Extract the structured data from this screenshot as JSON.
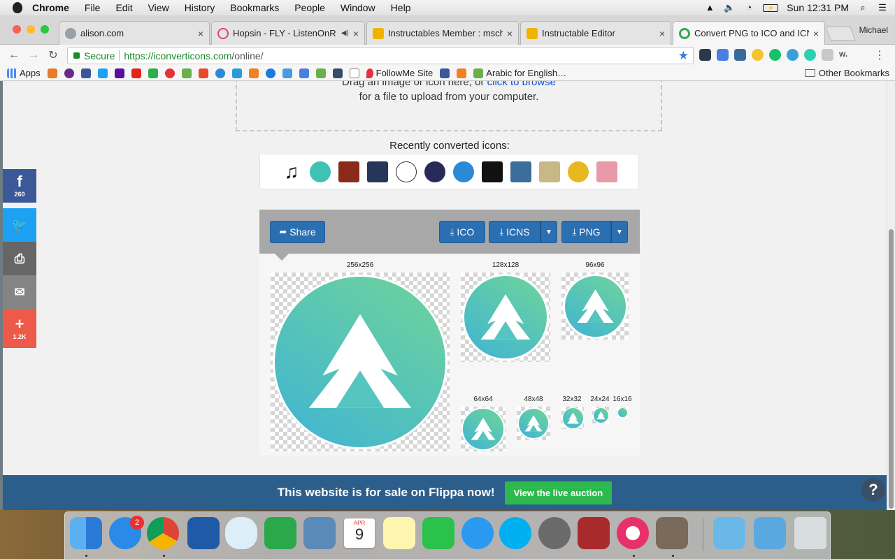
{
  "menubar": {
    "app": "Chrome",
    "items": [
      "File",
      "Edit",
      "View",
      "History",
      "Bookmarks",
      "People",
      "Window",
      "Help"
    ],
    "clock": "Sun 12:31 PM",
    "battery_icon": "battery-charging-icon"
  },
  "tabs": [
    {
      "title": "alison.com",
      "favicon_color": "#9aa0a6"
    },
    {
      "title": "Hopsin - FLY - ListenOnR",
      "favicon_color": "#e0446a"
    },
    {
      "title": "Instructables Member : msch",
      "favicon_color": "#f0b400"
    },
    {
      "title": "Instructable Editor",
      "favicon_color": "#f0b400"
    },
    {
      "title": "Convert PNG to ICO and ICN",
      "favicon_color": "#34a853"
    }
  ],
  "profile": "Michael",
  "omnibox": {
    "secure_label": "Secure",
    "url_host": "https://iconverticons.com",
    "url_path": "/online/"
  },
  "bookmarks": {
    "apps_label": "Apps",
    "followme_label": "FollowMe Site",
    "arabic_label": "Arabic for English…",
    "other_label": "Other Bookmarks"
  },
  "dropzone": {
    "line1_prefix": "Drag an image or icon here, or ",
    "browse_link": "click to browse",
    "line2": "for a file to upload from your computer."
  },
  "recent": {
    "title": "Recently converted icons:",
    "icon_colors": [
      "#111111",
      "#3fc1b4",
      "#8b2a1a",
      "#26355a",
      "#ffffff",
      "#2a2a5a",
      "#2a8ad8",
      "#111111",
      "#3b6e9a",
      "#c8b888",
      "#e8b820",
      "#e89aa8"
    ]
  },
  "toolbar": {
    "share": "Share",
    "ico": "ICO",
    "icns": "ICNS",
    "png": "PNG"
  },
  "sizes": [
    "256x256",
    "128x128",
    "96x96",
    "64x64",
    "48x48",
    "32x32",
    "24x24",
    "16x16"
  ],
  "social": {
    "facebook_count": "260",
    "add_count": "1.2K",
    "facebook_color": "#3b5998",
    "twitter_color": "#1da1f2",
    "print_color": "#666666",
    "email_color": "#848484",
    "add_color": "#ee5a4a"
  },
  "banner": {
    "message": "This website is for sale on Flippa now!",
    "button": "View the live auction"
  },
  "help_label": "?",
  "dock": {
    "appstore_badge": "2",
    "calendar_month": "APR",
    "calendar_day": "9"
  }
}
